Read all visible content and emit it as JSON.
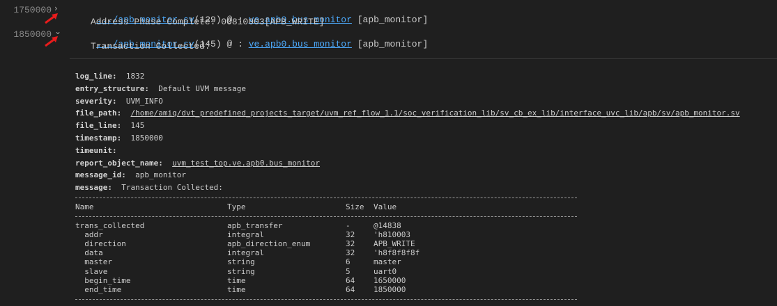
{
  "log_entries": [
    {
      "timestamp": "1750000",
      "expanded": false,
      "file_link": ".../apb_monitor.sv",
      "file_line": "(129)",
      "separator": " @ : ",
      "object_link": "ve.apb0.bus_monitor",
      "id": " [apb_monitor]",
      "message": "Address Phase Complete: 00810003[APB_WRITE]"
    },
    {
      "timestamp": "1850000",
      "expanded": true,
      "file_link": ".../apb_monitor.sv",
      "file_line": "(145)",
      "separator": " @ : ",
      "object_link": "ve.apb0.bus_monitor",
      "id": " [apb_monitor]",
      "message": "Transaction Collected:"
    }
  ],
  "annotation_color": "#e81c1c",
  "details": [
    {
      "key": "log_line:",
      "value": "1832",
      "link": false
    },
    {
      "key": "entry_structure:",
      "value": "Default UVM message",
      "link": false
    },
    {
      "key": "severity:",
      "value": "UVM_INFO",
      "link": false
    },
    {
      "key": "file_path:",
      "value": "/home/amiq/dvt_predefined_projects_target/uvm_ref_flow_1.1/soc_verification_lib/sv_cb_ex_lib/interface_uvc_lib/apb/sv/apb_monitor.sv",
      "link": true
    },
    {
      "key": "file_line:",
      "value": "145",
      "link": false
    },
    {
      "key": "timestamp:",
      "value": "1850000",
      "link": false
    },
    {
      "key": "timeunit:",
      "value": "",
      "link": false
    },
    {
      "key": "report_object_name:",
      "value": "uvm_test_top.ve.apb0.bus_monitor",
      "link": true
    },
    {
      "key": "message_id:",
      "value": "apb_monitor",
      "link": false
    },
    {
      "key": "message:",
      "value": "Transaction Collected:",
      "link": false
    }
  ],
  "table": {
    "headers": [
      "Name",
      "Type",
      "Size",
      "Value"
    ],
    "rows": [
      [
        "trans_collected",
        "apb_transfer",
        "-",
        "@14838"
      ],
      [
        "  addr",
        "integral",
        "32",
        "'h810003"
      ],
      [
        "  direction",
        "apb_direction_enum",
        "32",
        "APB_WRITE"
      ],
      [
        "  data",
        "integral",
        "32",
        "'h8f8f8f8f"
      ],
      [
        "  master",
        "string",
        "6",
        "master"
      ],
      [
        "  slave",
        "string",
        "5",
        "uart0"
      ],
      [
        "  begin_time",
        "time",
        "64",
        "1650000"
      ],
      [
        "  end_time",
        "time",
        "64",
        "1850000"
      ]
    ]
  }
}
